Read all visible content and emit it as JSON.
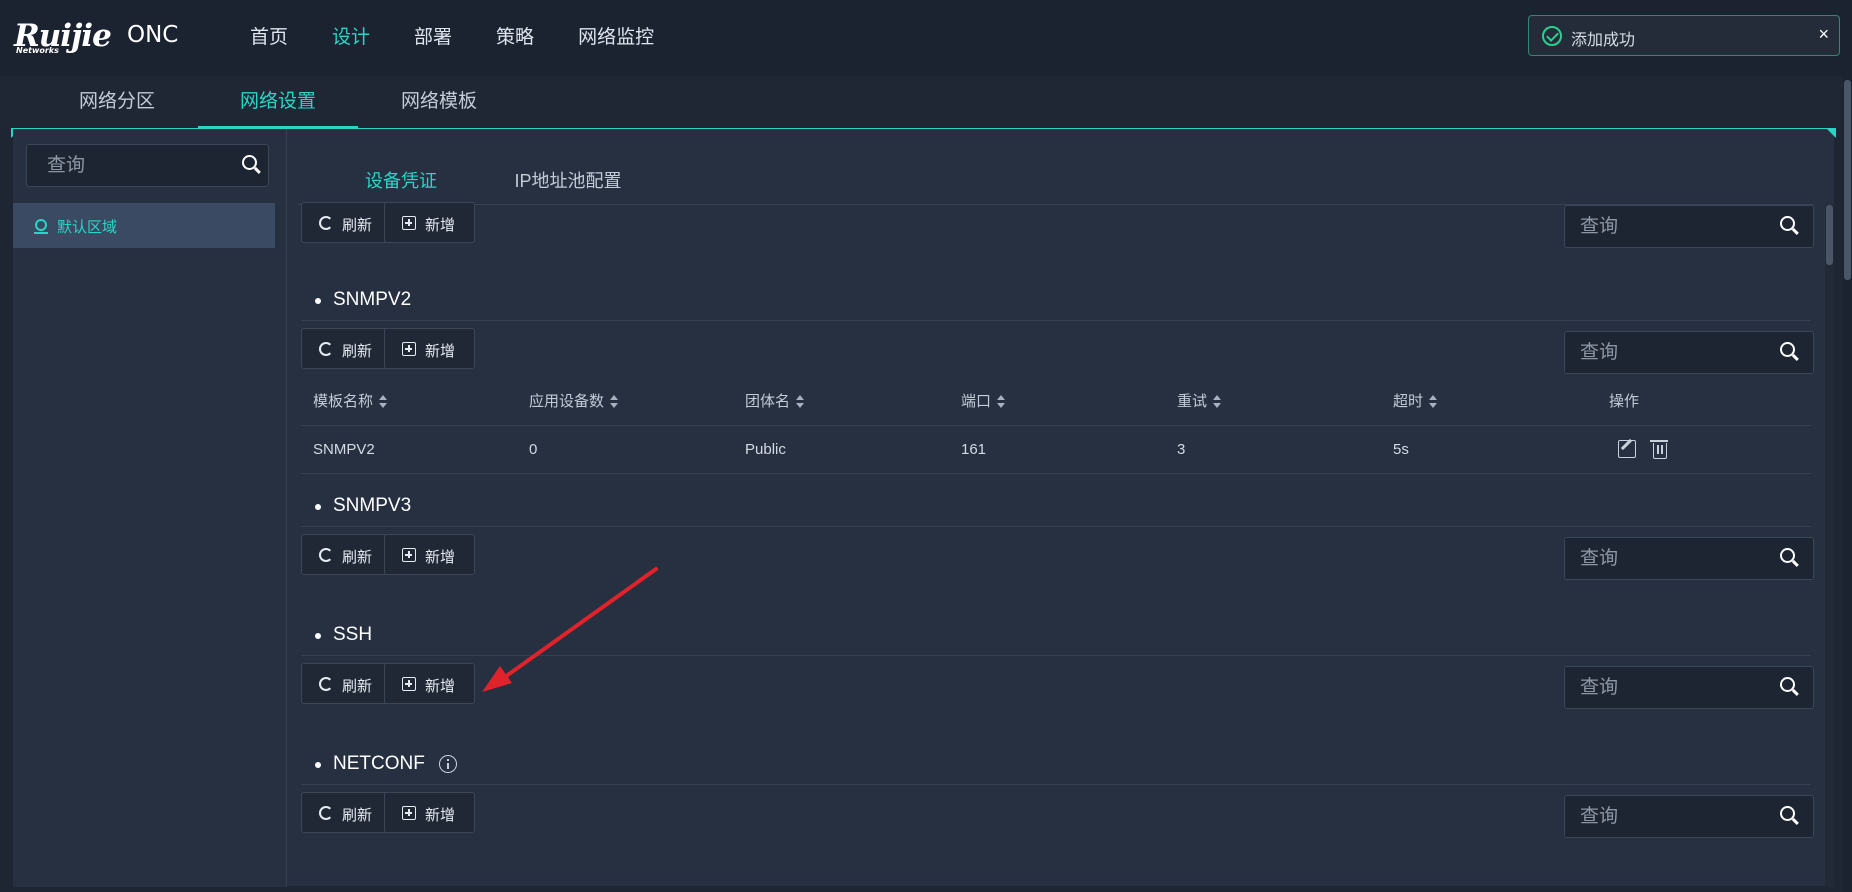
{
  "header": {
    "logo_text": "Ruijie",
    "logo_sub": "Networks",
    "logo_product": "ONC",
    "nav": [
      {
        "label": "首页"
      },
      {
        "label": "设计"
      },
      {
        "label": "部署"
      },
      {
        "label": "策略"
      },
      {
        "label": "网络监控"
      }
    ],
    "active_nav": "设计"
  },
  "toast": {
    "message": "添加成功",
    "close": "×"
  },
  "subnav": {
    "items": [
      {
        "label": "网络分区"
      },
      {
        "label": "网络设置"
      },
      {
        "label": "网络模板"
      }
    ],
    "active": "网络设置"
  },
  "sidebar": {
    "search_placeholder": "查询",
    "tree": [
      {
        "label": "默认区域"
      }
    ]
  },
  "content": {
    "tabs": [
      {
        "label": "设备凭证"
      },
      {
        "label": "IP地址池配置"
      }
    ],
    "active_tab": "设备凭证",
    "buttons": {
      "refresh": "刷新",
      "add": "新增"
    },
    "search_placeholder": "查询",
    "sections": [
      {
        "title": "SNMPV2"
      },
      {
        "title": "SNMPV3"
      },
      {
        "title": "SSH"
      },
      {
        "title": "NETCONF"
      }
    ],
    "table": {
      "columns": [
        "模板名称",
        "应用设备数",
        "团体名",
        "端口",
        "重试",
        "超时",
        "操作"
      ],
      "rows": [
        {
          "name": "SNMPV2",
          "devices": "0",
          "community": "Public",
          "port": "161",
          "retry": "3",
          "timeout": "5s"
        }
      ]
    }
  },
  "colors": {
    "accent": "#2ad5c8",
    "background": "#1e2533",
    "panel": "#263041",
    "annotation_arrow": "#e0232a",
    "toast_border": "#2e8a74",
    "success": "#2bd08f"
  }
}
